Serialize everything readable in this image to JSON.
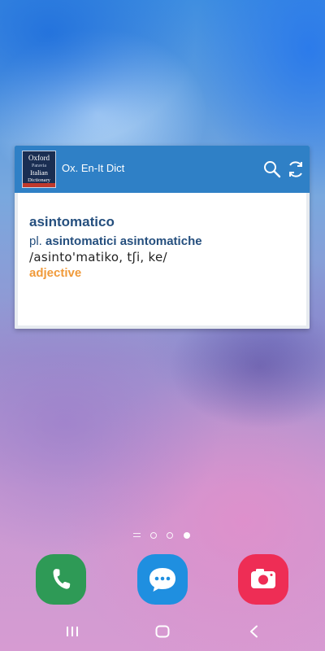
{
  "widget": {
    "app_title": "Ox. En-It Dict",
    "logo_text": [
      "Oxford",
      "Paravia",
      "Italian",
      "Dictionary"
    ]
  },
  "entry": {
    "headword": "asintomatico",
    "plural_prefix": "pl.",
    "plural_forms": "asintomatici asintomatiche",
    "pronunciation": "/asinto'matiko, tʃi, ke/",
    "part_of_speech": "adjective"
  },
  "pager": {
    "pages": 3,
    "current": 3
  },
  "dock": [
    {
      "name": "phone",
      "icon": "phone-icon",
      "color": "#2e9a56"
    },
    {
      "name": "messages",
      "icon": "chat-bubble-icon",
      "color": "#1f8fe0"
    },
    {
      "name": "camera",
      "icon": "camera-icon",
      "color": "#ee2d55"
    }
  ],
  "colors": {
    "header": "#2f80c6",
    "headword": "#254f7e",
    "part_of_speech": "#f09a3a"
  }
}
